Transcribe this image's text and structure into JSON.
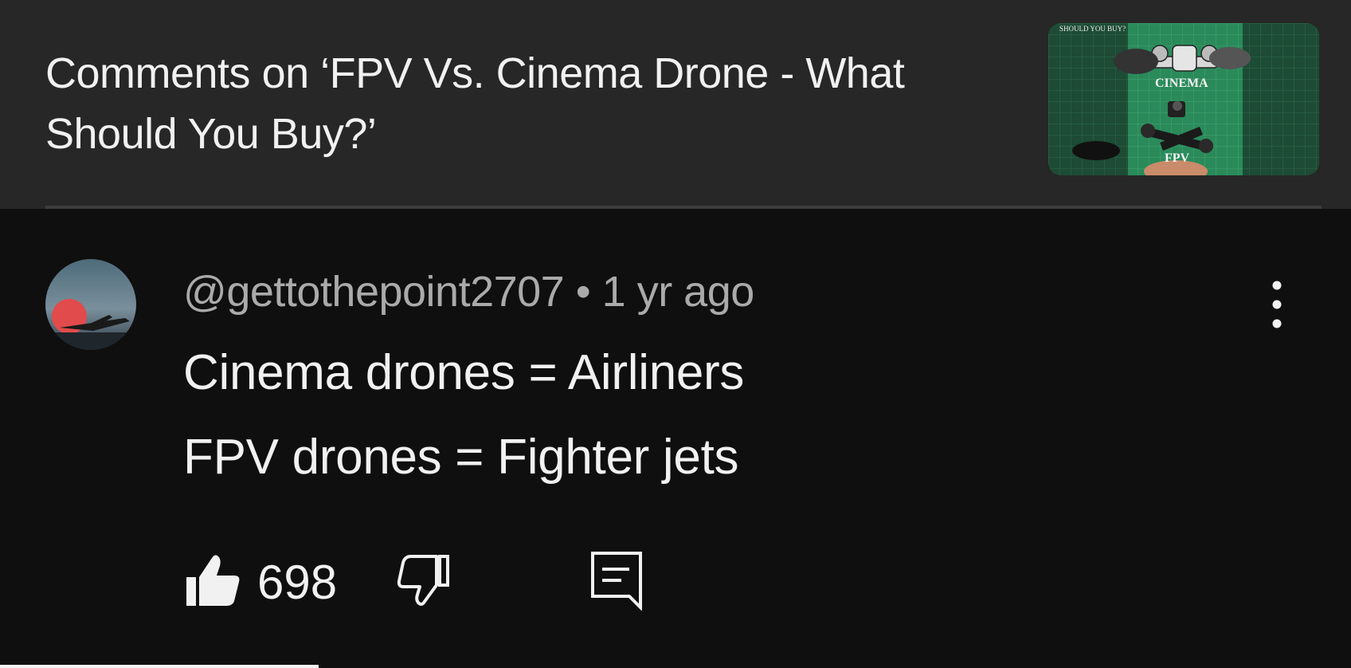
{
  "header": {
    "title": "Comments on ‘FPV Vs. Cinema Drone - What Should You Buy?’",
    "thumbnail": {
      "caption_top": "SHOULD YOU BUY?",
      "caption_middle": "CINEMA",
      "caption_bottom": "FPV"
    }
  },
  "comment": {
    "author": "@gettothepoint2707",
    "separator": "•",
    "time": "1 yr ago",
    "lines": [
      "Cinema drones = Airliners",
      "FPV drones = Fighter jets"
    ],
    "like_count": "698",
    "icons": {
      "avatar": "avatar-sunset-airplane",
      "menu": "more-vertical-icon",
      "like": "thumbs-up-filled-icon",
      "dislike": "thumbs-down-outline-icon",
      "reply": "reply-comment-icon"
    }
  },
  "colors": {
    "header_bg": "#272727",
    "body_bg": "#0f0f0f",
    "primary_text": "#f1f1f1",
    "secondary_text": "#aaaaaa"
  }
}
